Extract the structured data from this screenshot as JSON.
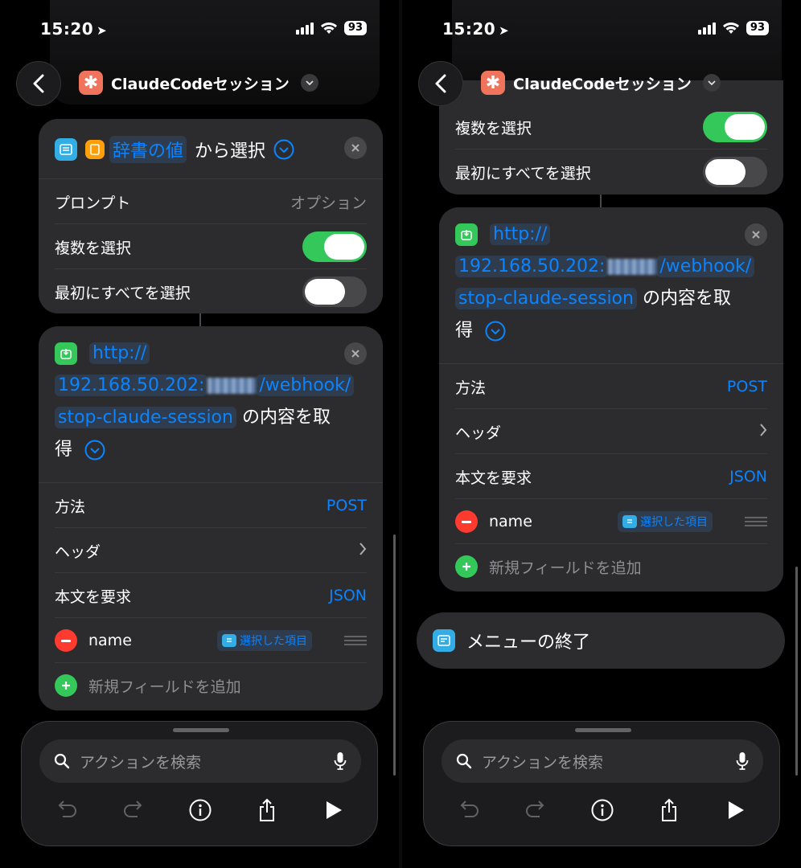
{
  "status": {
    "time": "15:20",
    "battery": "93"
  },
  "nav": {
    "title": "ClaudeCodeセッション"
  },
  "left": {
    "choose": {
      "var_label": "辞書の値",
      "suffix": "から選択",
      "rows": [
        {
          "label": "プロンプト",
          "value": "オプション"
        },
        {
          "label": "複数を選択",
          "toggle": "on"
        },
        {
          "label": "最初にすべてを選択",
          "toggle": "off"
        }
      ]
    },
    "url": {
      "part1": "http://",
      "part2": "192.168.50.202:",
      "part3": "/webhook/",
      "part4": "stop-claude-session",
      "suffix1": " の内容を取",
      "suffix2": "得",
      "method_label": "方法",
      "method_value": "POST",
      "headers_label": "ヘッダ",
      "body_label": "本文を要求",
      "body_value": "JSON",
      "field_key": "name",
      "field_value": "選択した項目",
      "add_field": "新規フィールドを追加"
    }
  },
  "right": {
    "rows": [
      {
        "label": "複数を選択",
        "toggle": "on"
      },
      {
        "label": "最初にすべてを選択",
        "toggle": "off"
      }
    ],
    "url": {
      "part1": "http://",
      "part2": "192.168.50.202:",
      "part3": "/webhook/",
      "part4": "stop-claude-session",
      "suffix1": " の内容を取",
      "suffix2": "得",
      "method_label": "方法",
      "method_value": "POST",
      "headers_label": "ヘッダ",
      "body_label": "本文を要求",
      "body_value": "JSON",
      "field_key": "name",
      "field_value": "選択した項目",
      "add_field": "新規フィールドを追加"
    },
    "end_menu": "メニューの終了"
  },
  "search": {
    "placeholder": "アクションを検索"
  },
  "icons": [
    "back-chevron-icon",
    "asterisk-icon",
    "chevron-down-icon",
    "list-icon",
    "book-icon",
    "close-icon",
    "download-icon",
    "chevron-right-icon",
    "minus-icon",
    "plus-icon",
    "drag-handle-icon",
    "search-icon",
    "mic-icon",
    "undo-icon",
    "redo-icon",
    "info-icon",
    "share-icon",
    "play-icon",
    "menu-end-icon"
  ],
  "colors": {
    "accent": "#0a84ff",
    "toggle_on": "#34c759",
    "app_icon": "#f0735b"
  }
}
